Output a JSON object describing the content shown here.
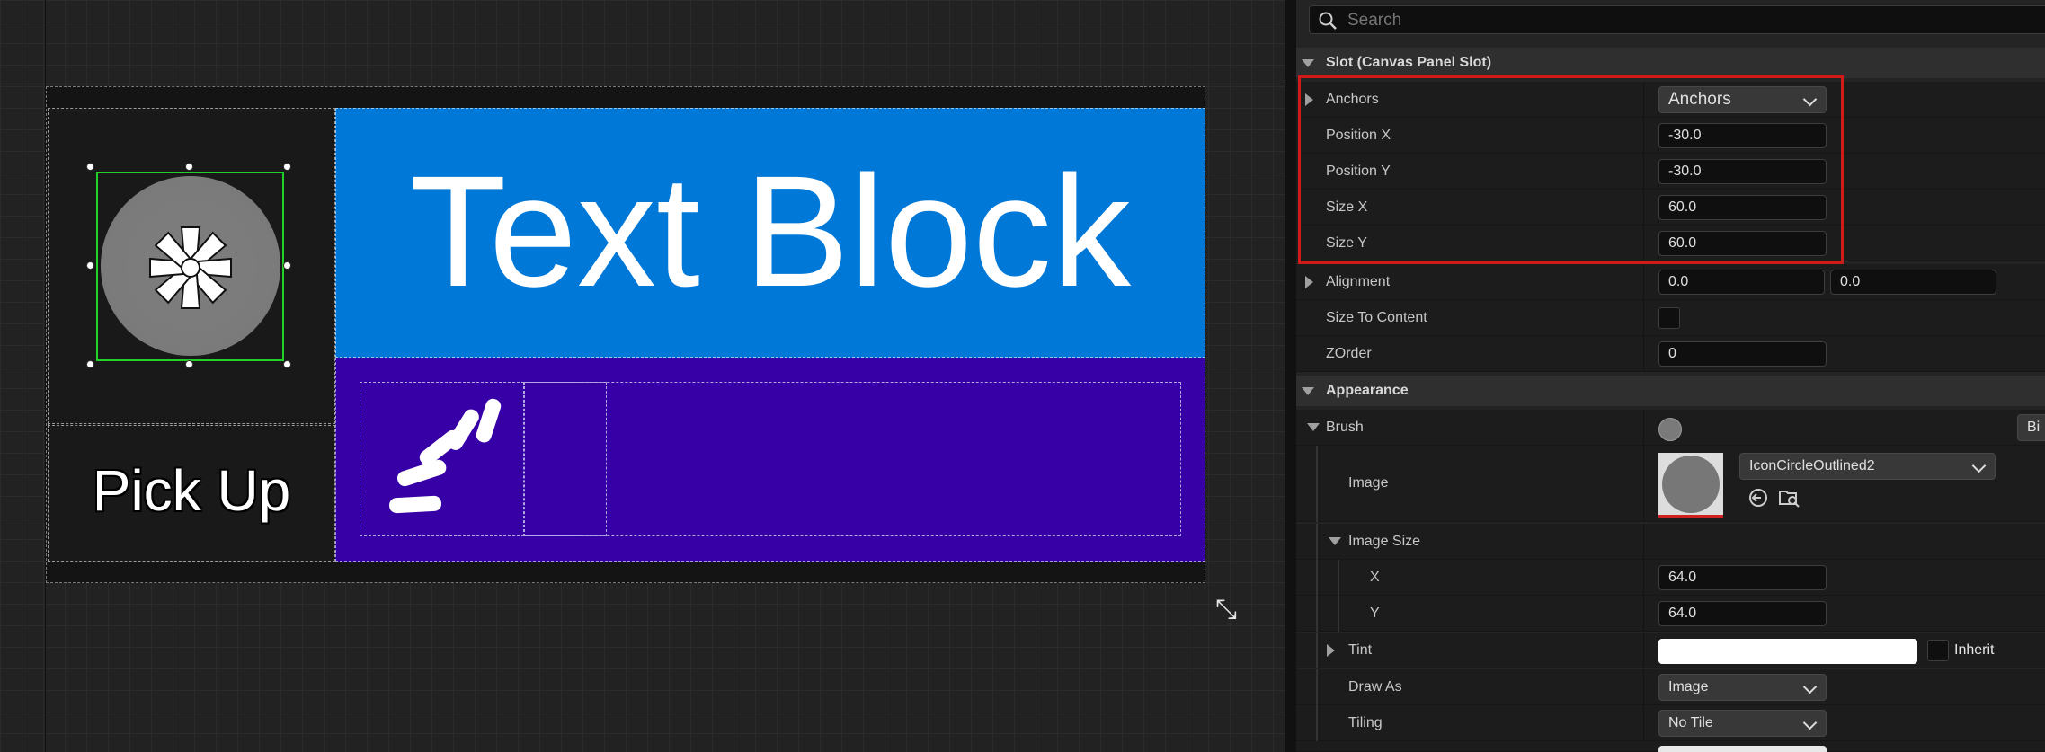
{
  "canvas": {
    "text_block": "Text Block",
    "pick_up": "Pick Up"
  },
  "details": {
    "search_placeholder": "Search",
    "slot_header": "Slot (Canvas Panel Slot)",
    "anchors": {
      "label": "Anchors",
      "value": "Anchors"
    },
    "position_x": {
      "label": "Position X",
      "value": "-30.0"
    },
    "position_y": {
      "label": "Position Y",
      "value": "-30.0"
    },
    "size_x": {
      "label": "Size X",
      "value": "60.0"
    },
    "size_y": {
      "label": "Size Y",
      "value": "60.0"
    },
    "alignment": {
      "label": "Alignment",
      "x": "0.0",
      "y": "0.0"
    },
    "size_to_content": {
      "label": "Size To Content",
      "checked": false
    },
    "zorder": {
      "label": "ZOrder",
      "value": "0"
    },
    "appearance_header": "Appearance",
    "brush": {
      "label": "Brush",
      "extra": "Bi"
    },
    "image": {
      "label": "Image",
      "asset": "IconCircleOutlined2"
    },
    "image_size": {
      "label": "Image Size",
      "x_label": "X",
      "x": "64.0",
      "y_label": "Y",
      "y": "64.0"
    },
    "tint": {
      "label": "Tint",
      "inherit": "Inherit",
      "color": "#ffffff"
    },
    "draw_as": {
      "label": "Draw As",
      "value": "Image"
    },
    "tiling": {
      "label": "Tiling",
      "value": "No Tile"
    }
  },
  "colors": {
    "text_block_bg": "#0078d7",
    "purple_bg": "#3700a6",
    "selection": "#22d128",
    "highlight_box": "#d11a1a"
  }
}
